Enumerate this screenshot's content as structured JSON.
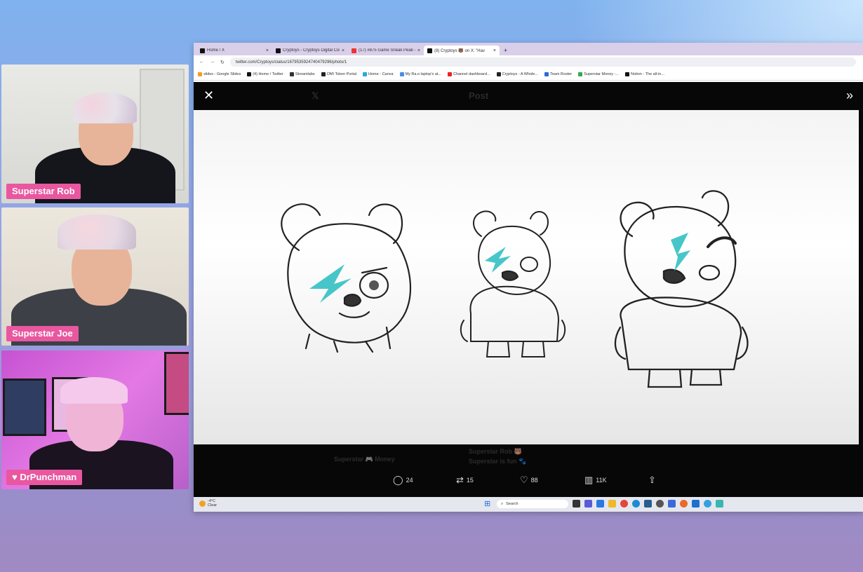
{
  "participants": [
    {
      "name": "Superstar Rob"
    },
    {
      "name": "Superstar Joe"
    },
    {
      "name": "DrPunchman",
      "badge_icon": "heart-icon"
    }
  ],
  "browser": {
    "tabs": [
      {
        "title": "Home / X",
        "favicon": "x-icon"
      },
      {
        "title": "Cryptoys - Cryptoys Digital Col",
        "favicon": "x-icon"
      },
      {
        "title": "(17) #875 Game Sneak Peak -",
        "favicon": "youtube-icon"
      },
      {
        "title": "(8) Cryptoys 🐻 on X: \"Hav",
        "favicon": "x-icon",
        "active": true
      }
    ],
    "url": "twitter.com/Cryptoys/status/1679535924740479296/photo/1",
    "bookmarks": [
      "slides - Google Slides",
      "(4) Home / Twitter",
      "Streamlabs",
      "OMI Token Portal",
      "Home - Canva",
      "My Ra.o laptop's at...",
      "Channel dashboard...",
      "Cryptoys - A Whole...",
      "Team Roster",
      "Superstar Money -...",
      "Notion - The all-in..."
    ]
  },
  "viewer": {
    "header_title": "Post",
    "stats": {
      "replies": "24",
      "reposts": "15",
      "likes": "88",
      "views": "11K"
    },
    "background_text": [
      "Superstar 🎮 Money",
      "Superstar Rob 🐻",
      "Superstar is fun 🐾"
    ]
  },
  "taskbar": {
    "temperature": "-4°C",
    "weather": "Clear",
    "search_placeholder": "Search"
  }
}
